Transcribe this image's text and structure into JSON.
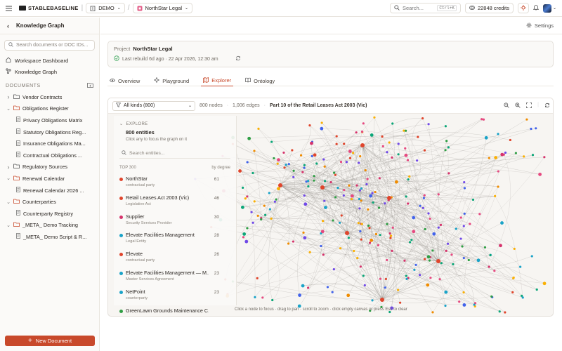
{
  "topbar": {
    "brand": "STABLEBASELINE",
    "workspace": "DEMO",
    "project": "NorthStar Legal",
    "search_placeholder": "Search...",
    "search_shortcut": "Ctrl+K",
    "credits": "22848 credits"
  },
  "sidebar": {
    "title": "Knowledge Graph",
    "search_placeholder": "Search documents or DOC IDs...",
    "nav": [
      {
        "label": "Workspace Dashboard",
        "icon": "home-icon"
      },
      {
        "label": "Knowledge Graph",
        "icon": "graph-icon"
      }
    ],
    "documents_label": "DOCUMENTS",
    "tree": [
      {
        "type": "folder",
        "label": "Vendor Contracts",
        "expanded": false
      },
      {
        "type": "folder",
        "label": "Obligations Register",
        "expanded": true
      },
      {
        "type": "doc",
        "label": "Privacy Obligations Matrix"
      },
      {
        "type": "doc",
        "label": "Statutory Obligations Reg..."
      },
      {
        "type": "doc",
        "label": "Insurance Obligations Ma..."
      },
      {
        "type": "doc",
        "label": "Contractual Obligations ..."
      },
      {
        "type": "folder",
        "label": "Regulatory Sources",
        "expanded": false
      },
      {
        "type": "folder",
        "label": "Renewal Calendar",
        "expanded": true
      },
      {
        "type": "doc",
        "label": "Renewal Calendar 2026 ..."
      },
      {
        "type": "folder",
        "label": "Counterparties",
        "expanded": true
      },
      {
        "type": "doc",
        "label": "Counterparty Registry"
      },
      {
        "type": "folder",
        "label": "_META_ Demo Tracking",
        "expanded": true
      },
      {
        "type": "doc",
        "label": "_META_ Demo Script & R..."
      }
    ],
    "new_document": "New Document"
  },
  "main": {
    "settings": "Settings",
    "project_label": "Project",
    "project_name": "NorthStar Legal",
    "rebuild_text": "Last rebuild 6d ago · 22 Apr 2026, 12:30 am",
    "tabs": [
      {
        "label": "Overview",
        "icon": "eye-icon",
        "active": false
      },
      {
        "label": "Playground",
        "icon": "sparkle-icon",
        "active": false
      },
      {
        "label": "Explorer",
        "icon": "map-icon",
        "active": true
      },
      {
        "label": "Ontology",
        "icon": "book-icon",
        "active": false
      }
    ]
  },
  "explorer": {
    "kind_filter": "All kinds (800)",
    "nodes": "800 nodes",
    "edges": "1,006 edges",
    "focus_title": "Part 10 of the Retail Leases Act 2003 (Vic)",
    "panel_kicker": "EXPLORE",
    "entity_count": "800 entities",
    "panel_help": "Click any to focus the graph on it",
    "entity_search_placeholder": "Search entities...",
    "list_heading": "TOP 300",
    "list_sort": "by degree",
    "entities": [
      {
        "name": "NorthStar",
        "type": "contractual party",
        "degree": "61",
        "color": "#e0452c"
      },
      {
        "name": "Retail Leases Act 2003 (Vic)",
        "type": "Legislative Act",
        "degree": "46",
        "color": "#e0452c"
      },
      {
        "name": "Supplier",
        "type": "Security Services Provider",
        "degree": "30",
        "color": "#d6336c"
      },
      {
        "name": "Elevate Facilities Management",
        "type": "Legal Entity",
        "degree": "28",
        "color": "#1aa3c8"
      },
      {
        "name": "Elevate",
        "type": "contractual party",
        "degree": "26",
        "color": "#e0452c"
      },
      {
        "name": "Elevate Facilities Management — M...",
        "type": "Master Services Agreement",
        "degree": "23",
        "color": "#1aa3c8"
      },
      {
        "name": "NetPoint",
        "type": "counterparty",
        "degree": "23",
        "color": "#1aa3c8"
      },
      {
        "name": "GreenLawn Grounds Maintenance C...",
        "type": "",
        "degree": "",
        "color": "#2f9e44"
      }
    ],
    "canvas_hint": "Click a node to focus · drag to pan · scroll to zoom · click empty canvas or press Esc to clear"
  }
}
